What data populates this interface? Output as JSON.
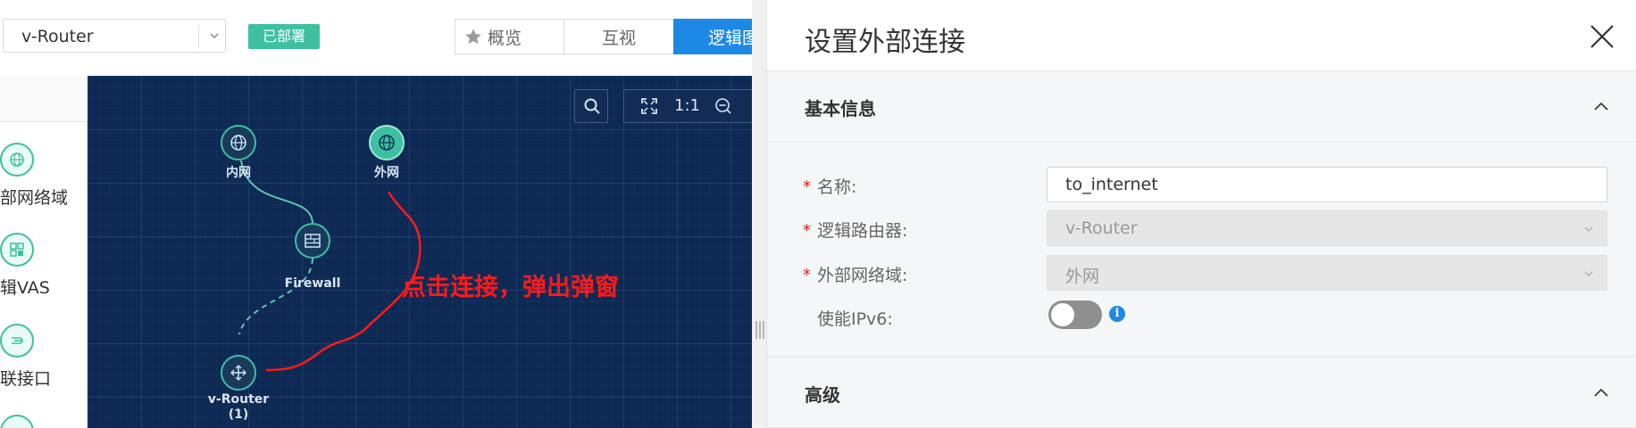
{
  "topbar": {
    "router_select_value": "v-Router",
    "status_badge": "已部署",
    "tabs": [
      {
        "label": "概览",
        "icon": "star-icon"
      },
      {
        "label": "互视"
      },
      {
        "label": "逻辑图",
        "active": true
      }
    ]
  },
  "palette": {
    "items": [
      {
        "label": "部网络域",
        "icon": "network-domain-icon"
      },
      {
        "label": "辑VAS",
        "icon": "vas-icon"
      },
      {
        "label": "联接口",
        "icon": "interface-icon"
      }
    ]
  },
  "canvas": {
    "zoom_label": "1:1",
    "nodes": [
      {
        "label": "内网",
        "icon": "network-domain-icon"
      },
      {
        "label": "外网",
        "icon": "network-domain-icon",
        "highlighted": true
      },
      {
        "label": "Firewall",
        "icon": "firewall-icon"
      },
      {
        "label": "v-Router",
        "sublabel": "(1)",
        "icon": "router-icon"
      }
    ],
    "annotation": "点击连接，弹出弹窗",
    "colors": {
      "node": "#3dc0a0",
      "annotation": "#ff1a1a",
      "background": "#0e2a54"
    }
  },
  "drawer": {
    "title": "设置外部连接",
    "sections": [
      {
        "title": "基本信息",
        "expanded": true
      },
      {
        "title": "高级",
        "expanded": true
      }
    ],
    "fields": {
      "name": {
        "label": "名称:",
        "required": true,
        "value": "to_internet"
      },
      "router": {
        "label": "逻辑路由器:",
        "required": true,
        "value": "v-Router",
        "disabled": true
      },
      "external_domain": {
        "label": "外部网络域:",
        "required": true,
        "value": "外网",
        "disabled": true
      },
      "ipv6": {
        "label": "使能IPv6:",
        "enabled": false,
        "info_icon": "info-icon"
      }
    },
    "required_mark": "*"
  }
}
